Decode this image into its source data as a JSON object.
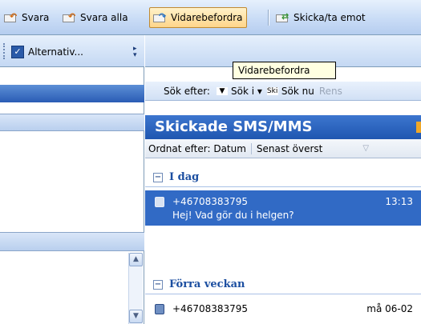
{
  "toolbar": {
    "reply_label": "Svara",
    "reply_all_label": "Svara alla",
    "forward_label": "Vidarebefordra",
    "send_receive_label": "Skicka/ta emot"
  },
  "options_toolbar": {
    "options_label": "Alternativ..."
  },
  "tooltip": {
    "text": "Vidarebefordra"
  },
  "search": {
    "look_for_label": "Sök efter:",
    "search_in_label": "Sök i",
    "scope_box_text": "Ski",
    "find_now_label": "Sök nu",
    "clear_label": "Rens"
  },
  "folder": {
    "title": "Skickade SMS/MMS",
    "arrange_by_label": "Ordnat efter: Datum",
    "sort_order_label": "Senast överst"
  },
  "groups": [
    {
      "name": "I dag",
      "messages": [
        {
          "sender": "+46708383795",
          "time": "13:13",
          "preview": "Hej! Vad gör du i helgen?"
        }
      ]
    },
    {
      "name": "Förra veckan",
      "messages": [
        {
          "sender": "+46708383795",
          "time": "må 06-02",
          "preview": ""
        }
      ]
    }
  ],
  "colors": {
    "accent": "#316ac5",
    "title_bar": "#2a60b8",
    "tooltip_bg": "#ffffe1"
  }
}
